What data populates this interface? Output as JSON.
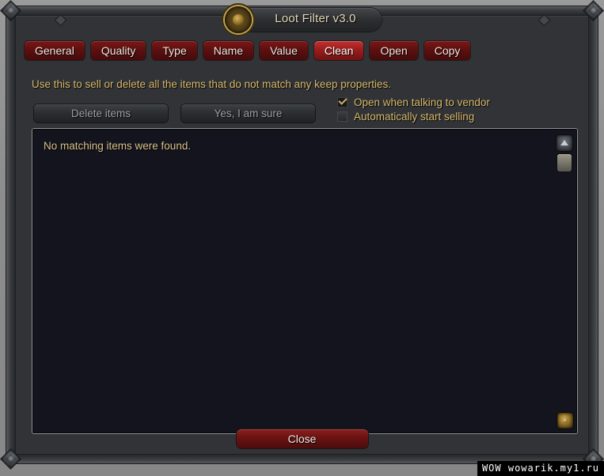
{
  "window": {
    "title": "Loot Filter v3.0",
    "emblem_icon": "gold-ring-emblem-icon"
  },
  "tabs": [
    {
      "label": "General",
      "active": false
    },
    {
      "label": "Quality",
      "active": false
    },
    {
      "label": "Type",
      "active": false
    },
    {
      "label": "Name",
      "active": false
    },
    {
      "label": "Value",
      "active": false
    },
    {
      "label": "Clean",
      "active": true
    },
    {
      "label": "Open",
      "active": false
    },
    {
      "label": "Copy",
      "active": false
    }
  ],
  "description": "Use this to sell or delete all the items that do not match any keep properties.",
  "actions": {
    "delete_label": "Delete items",
    "confirm_label": "Yes, I am sure"
  },
  "options": [
    {
      "label": "Open when talking to vendor",
      "checked": true,
      "enabled": true
    },
    {
      "label": "Automatically start selling",
      "checked": false,
      "enabled": false
    }
  ],
  "panel": {
    "message": "No matching items were found.",
    "scroll_up_icon": "scroll-up-arrow-icon",
    "resize_icon": "resize-grip-icon"
  },
  "footer": {
    "close_label": "Close"
  },
  "watermark": "WOW  wowarik.my1.ru",
  "colors": {
    "accent_gold": "#d8b96b",
    "tab_red": "#5d1010",
    "tab_red_active": "#9c1d1d",
    "panel_bg": "#14141e",
    "frame": "#3a3c40"
  }
}
